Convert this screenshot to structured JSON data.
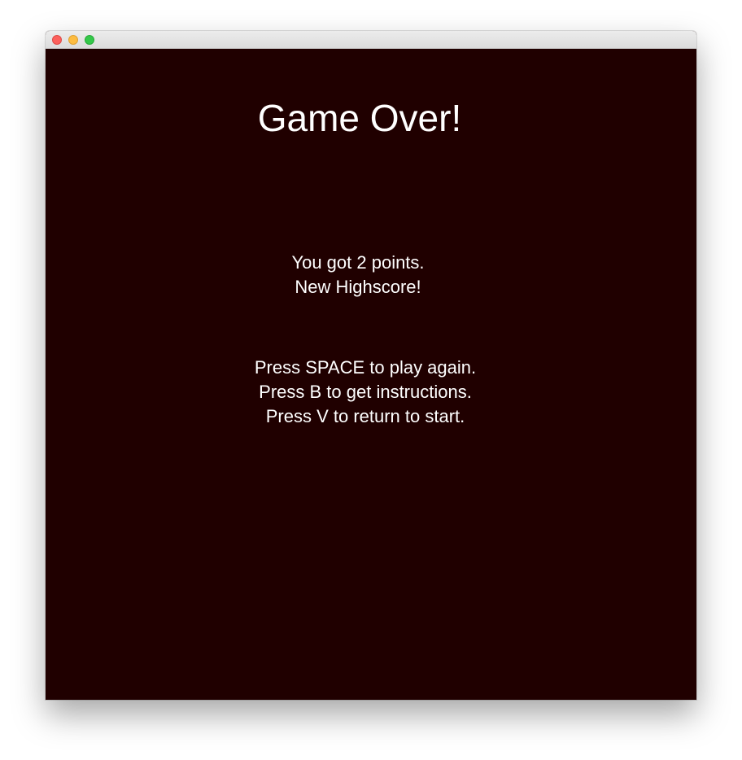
{
  "window": {
    "controls": {
      "close": "close-icon",
      "minimize": "minimize-icon",
      "maximize": "maximize-icon"
    }
  },
  "game": {
    "title": "Game Over!",
    "score_text": "You got 2 points.",
    "score_value": 2,
    "highscore_text": "New Highscore!",
    "instructions": [
      "Press SPACE to play again.",
      "Press B to get instructions.",
      "Press V to return to start."
    ]
  },
  "colors": {
    "background": "#200000",
    "text": "#ffffff"
  }
}
